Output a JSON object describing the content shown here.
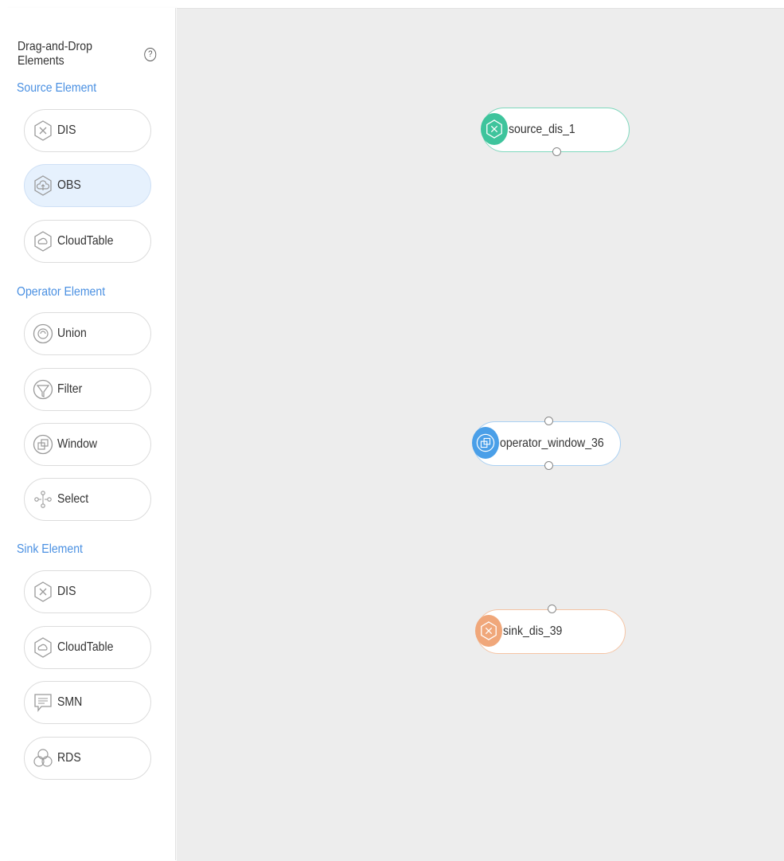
{
  "palette": {
    "title": "Drag-and-Drop Elements",
    "help_icon": "help-icon",
    "sections": {
      "source": {
        "label": "Source Element",
        "items": [
          {
            "label": "DIS",
            "icon": "dis-icon"
          },
          {
            "label": "OBS",
            "icon": "obs-icon"
          },
          {
            "label": "CloudTable",
            "icon": "cloudtable-icon"
          }
        ]
      },
      "operator": {
        "label": "Operator Element",
        "items": [
          {
            "label": "Union",
            "icon": "union-icon"
          },
          {
            "label": "Filter",
            "icon": "filter-icon"
          },
          {
            "label": "Window",
            "icon": "window-icon"
          },
          {
            "label": "Select",
            "icon": "select-icon"
          }
        ]
      },
      "sink": {
        "label": "Sink Element",
        "items": [
          {
            "label": "DIS",
            "icon": "dis-icon"
          },
          {
            "label": "CloudTable",
            "icon": "cloudtable-icon"
          },
          {
            "label": "SMN",
            "icon": "smn-icon"
          },
          {
            "label": "RDS",
            "icon": "rds-icon"
          }
        ]
      }
    },
    "selected_item": "OBS"
  },
  "canvas": {
    "nodes": [
      {
        "label": "source_dis_1",
        "type": "source",
        "color": "#3ec49c"
      },
      {
        "label": "operator_window_36",
        "type": "operator",
        "color": "#4a9fe8"
      },
      {
        "label": "sink_dis_39",
        "type": "sink",
        "color": "#f0a77a"
      }
    ]
  },
  "colors": {
    "accent": "#4a90e2",
    "canvas_bg": "#ededed",
    "selected_bg": "#e6f1fd"
  }
}
